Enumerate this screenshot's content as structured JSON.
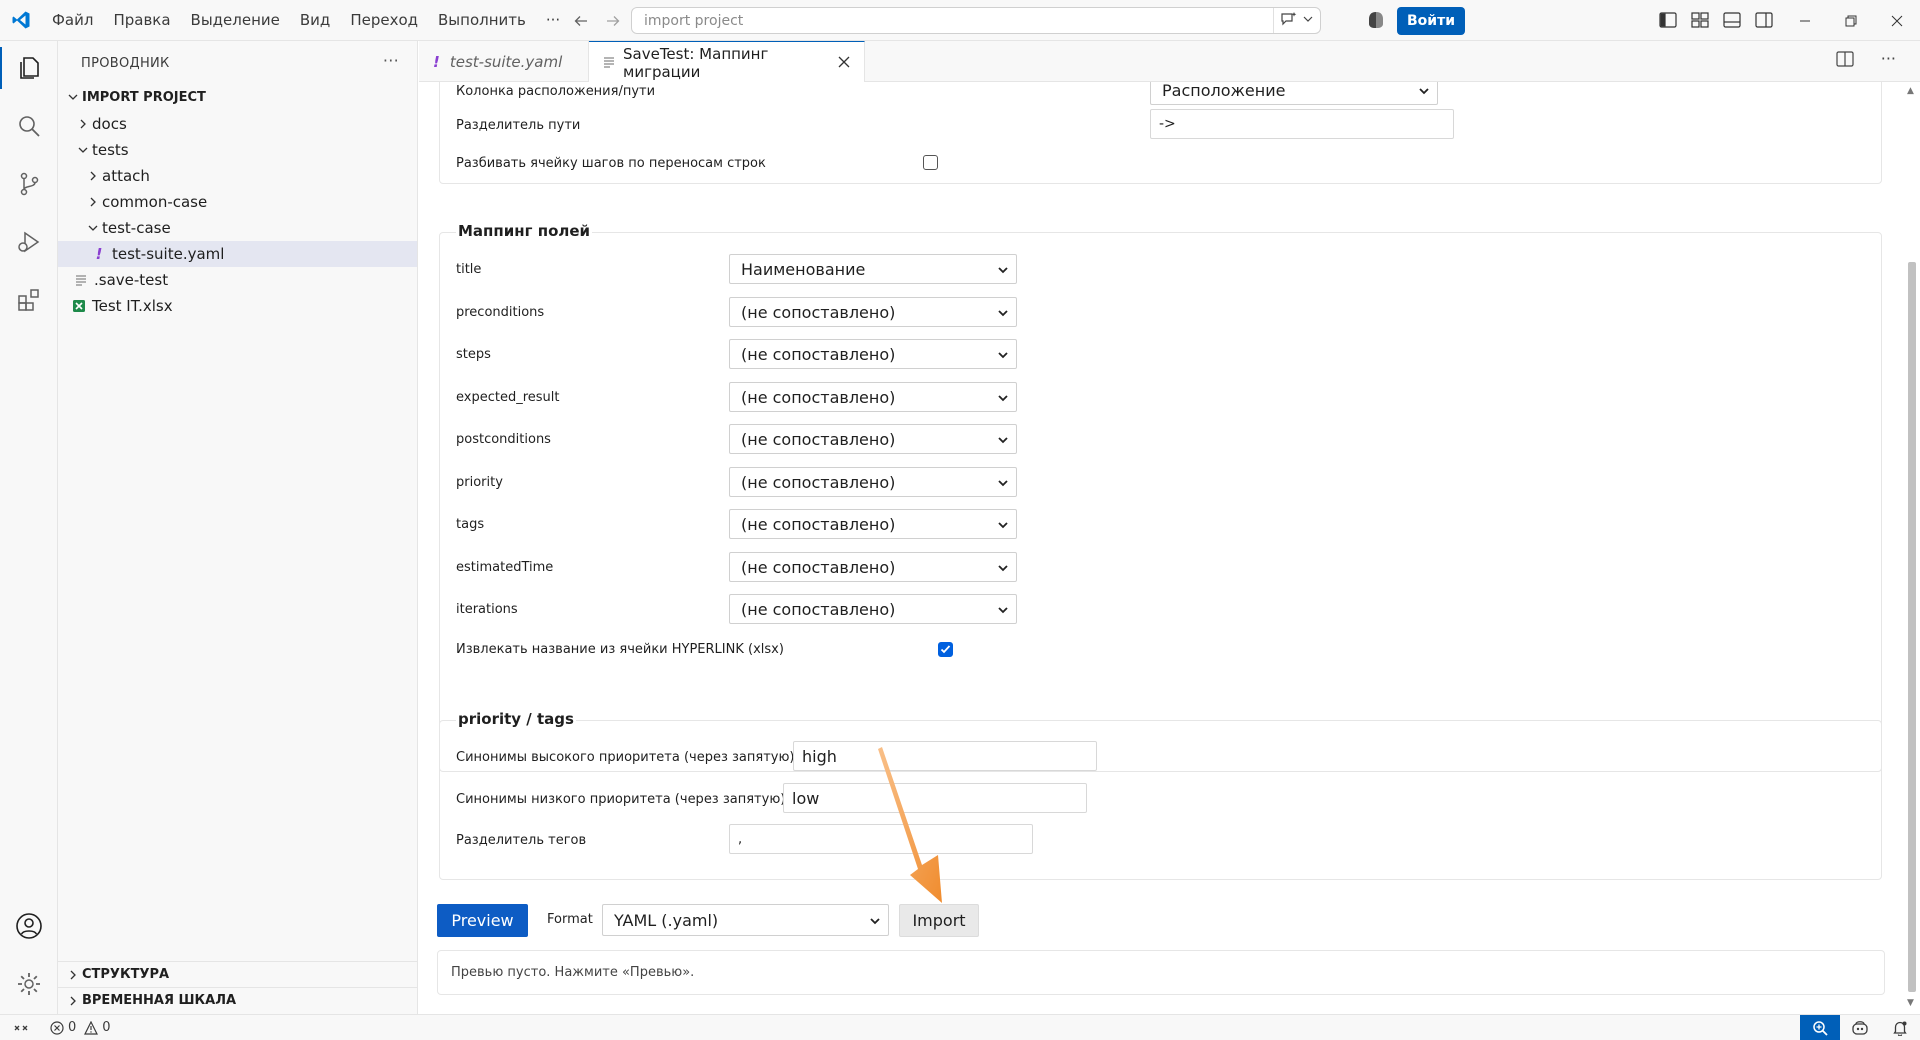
{
  "titlebar": {
    "menu": [
      "Файл",
      "Правка",
      "Выделение",
      "Вид",
      "Переход",
      "Выполнить",
      "···"
    ],
    "search_placeholder": "import project",
    "signin_label": "Войти"
  },
  "sidebar": {
    "header": "ПРОВОДНИК",
    "root": "IMPORT PROJECT",
    "tree": [
      {
        "label": "docs",
        "depth": 1,
        "kind": "folder",
        "expanded": false
      },
      {
        "label": "tests",
        "depth": 1,
        "kind": "folder",
        "expanded": true
      },
      {
        "label": "attach",
        "depth": 2,
        "kind": "folder",
        "expanded": false
      },
      {
        "label": "common-case",
        "depth": 2,
        "kind": "folder",
        "expanded": false
      },
      {
        "label": "test-case",
        "depth": 2,
        "kind": "folder",
        "expanded": true
      },
      {
        "label": "test-suite.yaml",
        "depth": 3,
        "kind": "yaml",
        "selected": true
      },
      {
        "label": ".save-test",
        "depth": 1,
        "kind": "text"
      },
      {
        "label": "Test IT.xlsx",
        "depth": 1,
        "kind": "xlsx"
      }
    ],
    "outline_label": "СТРУКТУРА",
    "timeline_label": "ВРЕМЕННАЯ ШКАЛА"
  },
  "tabs": [
    {
      "label": "test-suite.yaml",
      "active": false
    },
    {
      "label": "SaveTest: Маппинг миграции",
      "active": true
    }
  ],
  "top_section": {
    "partial_label": "Колонка расположения/пути",
    "partial_value": "Расположение",
    "path_sep_label": "Разделитель пути",
    "path_sep_value": "->",
    "split_steps_label": "Разбивать ячейку шагов по переносам строк",
    "split_steps_checked": false
  },
  "mapping": {
    "title": "Маппинг полей",
    "fields": [
      {
        "name": "title",
        "value": "Наименование"
      },
      {
        "name": "preconditions",
        "value": "(не сопоставлено)"
      },
      {
        "name": "steps",
        "value": "(не сопоставлено)"
      },
      {
        "name": "expected_result",
        "value": "(не сопоставлено)"
      },
      {
        "name": "postconditions",
        "value": "(не сопоставлено)"
      },
      {
        "name": "priority",
        "value": "(не сопоставлено)"
      },
      {
        "name": "tags",
        "value": "(не сопоставлено)"
      },
      {
        "name": "estimatedTime",
        "value": "(не сопоставлено)"
      },
      {
        "name": "iterations",
        "value": "(не сопоставлено)"
      }
    ],
    "hyperlink_label": "Извлекать название из ячейки HYPERLINK (xlsx)",
    "hyperlink_checked": true
  },
  "priority_tags": {
    "title": "priority / tags",
    "high_label": "Синонимы высокого приоритета (через запятую)",
    "high_value": "high",
    "low_label": "Синонимы низкого приоритета (через запятую)",
    "low_value": "low",
    "tag_sep_label": "Разделитель тегов",
    "tag_sep_value": ","
  },
  "actions": {
    "preview_label": "Preview",
    "format_label": "Format",
    "format_value": "YAML (.yaml)",
    "import_label": "Import",
    "preview_empty": "Превью пусто. Нажмите «Превью»."
  },
  "statusbar": {
    "errors": "0",
    "warnings": "0"
  },
  "colors": {
    "accent": "#005fb8",
    "annotation_arrow": "#f5a04a"
  }
}
